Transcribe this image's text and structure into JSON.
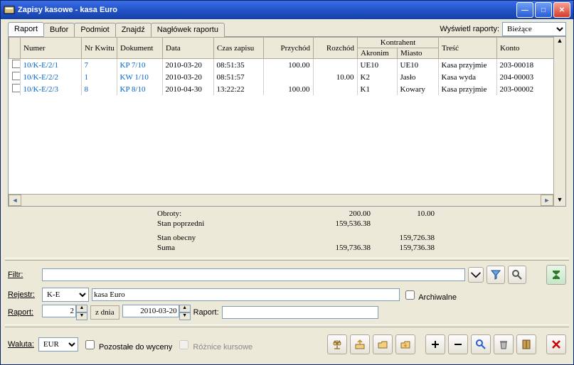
{
  "window": {
    "title": "Zapisy kasowe - kasa Euro"
  },
  "tabs": {
    "items": [
      "Raport",
      "Bufor",
      "Podmiot",
      "Znajdź",
      "Nagłówek raportu"
    ],
    "active": 0
  },
  "raportfilter": {
    "label": "Wyświetl raporty:",
    "value": "Bieżące"
  },
  "columns": {
    "numer": "Numer",
    "nrkwitu": "Nr Kwitu",
    "dokument": "Dokument",
    "data": "Data",
    "czas": "Czas zapisu",
    "przychod": "Przychód",
    "rozchod": "Rozchód",
    "kontrahent": "Kontrahent",
    "akronim": "Akronim",
    "miasto": "Miasto",
    "tresc": "Treść",
    "konto": "Konto"
  },
  "rows": [
    {
      "numer": "10/K-E/2/1",
      "nrkwitu": "7",
      "dokument": "KP 7/10",
      "data": "2010-03-20",
      "czas": "08:51:35",
      "przychod": "100.00",
      "rozchod": "",
      "akronim": "UE10",
      "miasto": "UE10",
      "tresc": "Kasa przyjmie",
      "konto": "203-00018"
    },
    {
      "numer": "10/K-E/2/2",
      "nrkwitu": "1",
      "dokument": "KW 1/10",
      "data": "2010-03-20",
      "czas": "08:51:57",
      "przychod": "",
      "rozchod": "10.00",
      "akronim": "K2",
      "miasto": "Jasło",
      "tresc": "Kasa wyda",
      "konto": "204-00003"
    },
    {
      "numer": "10/K-E/2/3",
      "nrkwitu": "8",
      "dokument": "KP 8/10",
      "data": "2010-04-30",
      "czas": "13:22:22",
      "przychod": "100.00",
      "rozchod": "",
      "akronim": "K1",
      "miasto": "Kowary",
      "tresc": "Kasa przyjmie",
      "konto": "203-00002"
    }
  ],
  "summary": {
    "obroty_lbl": "Obroty:",
    "obroty_p": "200.00",
    "obroty_r": "10.00",
    "stanpop_lbl": "Stan poprzedni",
    "stanpop": "159,536.38",
    "stanob_lbl": "Stan obecny",
    "stanob": "159,726.38",
    "suma_lbl": "Suma",
    "suma_p": "159,736.38",
    "suma_r": "159,736.38"
  },
  "form": {
    "filtr_lbl": "Filtr:",
    "filtr_val": "",
    "rejestr_lbl": "Rejestr:",
    "rejestr_val": "K-E",
    "rejestr_desc": "kasa Euro",
    "archiwalne_lbl": "Archiwalne",
    "raport_lbl": "Raport:",
    "raport_val": "2",
    "zdnia_lbl": "z dnia",
    "zdnia_val": "2010-03-20",
    "raport2_lbl": "Raport:",
    "raport2_val": "",
    "waluta_lbl": "Waluta:",
    "waluta_val": "EUR",
    "pozostale_lbl": "Pozostałe do wyceny",
    "roznice_lbl": "Różnice kursowe"
  },
  "icons": {
    "funnel": "funnel-icon",
    "search": "search-icon",
    "sum": "sigma-icon",
    "scales": "scales-icon",
    "up": "arrow-up-icon",
    "open": "folder-open-icon",
    "save": "folder-save-icon",
    "plus": "plus-icon",
    "minus": "minus-icon",
    "zoom": "magnifier-icon",
    "trash": "trash-icon",
    "book": "book-icon",
    "close": "close-x-icon"
  }
}
